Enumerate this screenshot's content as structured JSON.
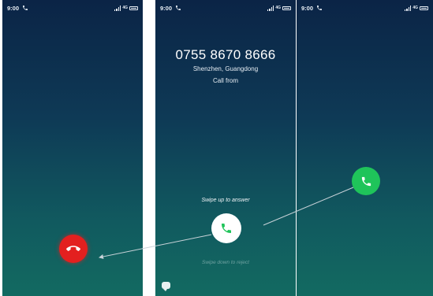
{
  "screens": {
    "left": {
      "status_time": "9:00"
    },
    "middle": {
      "status_time": "9:00",
      "caller_number": "0755 8670 8666",
      "caller_location": "Shenzhen, Guangdong",
      "call_from": "Call from",
      "swipe_up_hint": "Swipe up to answer",
      "swipe_down_hint": "Swipe down to reject"
    },
    "right": {
      "status_time": "9:00"
    }
  },
  "colors": {
    "decline": "#e3201f",
    "answer": "#1fc45a",
    "background_top": "#0b2446",
    "background_bottom": "#126a61"
  },
  "icons": {
    "decline": "phone-hangup-icon",
    "answer": "phone-answer-icon",
    "status_call": "phone-small-icon",
    "message": "message-icon"
  }
}
